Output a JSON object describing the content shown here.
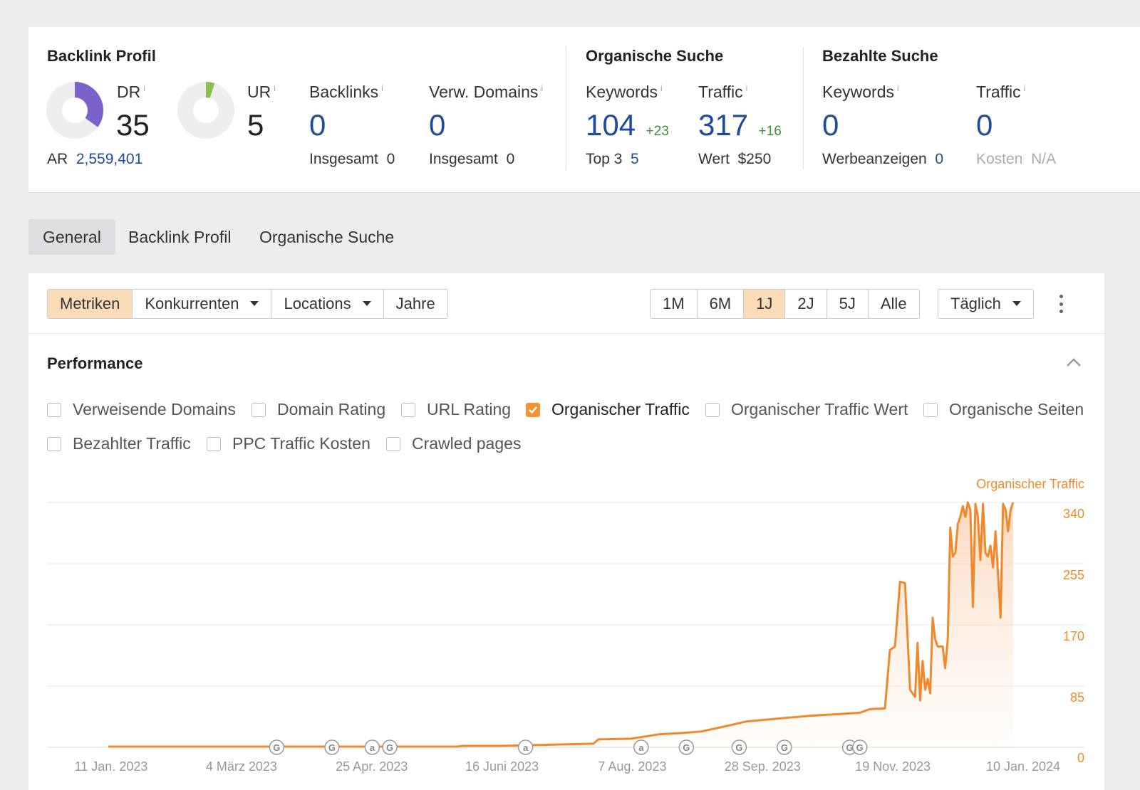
{
  "colors": {
    "accent": "#f29436",
    "link": "#1f4b9e",
    "positive": "#3d8f3d"
  },
  "backlink": {
    "title": "Backlink Profil",
    "dr": {
      "label": "DR",
      "info": "i",
      "value": "35",
      "fill": 0.35
    },
    "ur": {
      "label": "UR",
      "info": "i",
      "value": "5",
      "fill": 0.05
    },
    "ar_label": "AR",
    "ar_value": "2,559,401",
    "backlinks": {
      "label": "Backlinks",
      "info": "i",
      "value": "0",
      "sub_label": "Insgesamt",
      "sub_value": "0"
    },
    "domains": {
      "label": "Verw. Domains",
      "info": "i",
      "value": "0",
      "sub_label": "Insgesamt",
      "sub_value": "0"
    }
  },
  "organic": {
    "title": "Organische Suche",
    "keywords": {
      "label": "Keywords",
      "info": "i",
      "value": "104",
      "delta": "+23",
      "sub_label": "Top 3",
      "sub_value": "5"
    },
    "traffic": {
      "label": "Traffic",
      "info": "i",
      "value": "317",
      "delta": "+16",
      "sub_label": "Wert",
      "sub_value": "$250"
    }
  },
  "paid": {
    "title": "Bezahlte Suche",
    "keywords": {
      "label": "Keywords",
      "info": "i",
      "value": "0",
      "sub_label": "Werbeanzeigen",
      "sub_value": "0"
    },
    "traffic": {
      "label": "Traffic",
      "info": "i",
      "value": "0",
      "sub_label": "Kosten",
      "sub_value": "N/A"
    }
  },
  "tabs": [
    "General",
    "Backlink Profil",
    "Organische Suche"
  ],
  "toolbar": {
    "left": [
      "Metriken",
      "Konkurrenten",
      "Locations",
      "Jahre"
    ],
    "ranges": [
      "1M",
      "6M",
      "1J",
      "2J",
      "5J",
      "Alle"
    ],
    "interval": "Täglich",
    "active_range": "1J"
  },
  "performance": {
    "title": "Performance",
    "checkboxes": [
      {
        "label": "Verweisende Domains",
        "checked": false
      },
      {
        "label": "Domain Rating",
        "checked": false
      },
      {
        "label": "URL Rating",
        "checked": false
      },
      {
        "label": "Organischer Traffic",
        "checked": true
      },
      {
        "label": "Organischer Traffic Wert",
        "checked": false
      },
      {
        "label": "Organische Seiten",
        "checked": false
      },
      {
        "label": "Bezahlter Traffic",
        "checked": false
      },
      {
        "label": "PPC Traffic Kosten",
        "checked": false
      },
      {
        "label": "Crawled pages",
        "checked": false
      }
    ]
  },
  "chart_data": {
    "type": "area",
    "series": [
      {
        "name": "Organischer Traffic",
        "color": "#f29436"
      }
    ],
    "x_ticks": [
      "11 Jan. 2023",
      "4 März 2023",
      "25 Apr. 2023",
      "16 Juni 2023",
      "7 Aug. 2023",
      "28 Sep. 2023",
      "19 Nov. 2023",
      "10 Jan. 2024"
    ],
    "y_ticks": [
      "0",
      "85",
      "170",
      "255",
      "340"
    ],
    "ylim": [
      0,
      340
    ],
    "xlim": [
      "2023-01-11",
      "2024-01-10"
    ],
    "grid": true,
    "annotations": [
      {
        "date": "2023-03-19",
        "label": "G"
      },
      {
        "date": "2023-04-10",
        "label": "G"
      },
      {
        "date": "2023-04-26",
        "label": "a"
      },
      {
        "date": "2023-05-03",
        "label": "G"
      },
      {
        "date": "2023-06-26",
        "label": "a"
      },
      {
        "date": "2023-08-11",
        "label": "a"
      },
      {
        "date": "2023-08-29",
        "label": "G"
      },
      {
        "date": "2023-09-19",
        "label": "G"
      },
      {
        "date": "2023-10-07",
        "label": "G"
      },
      {
        "date": "2023-11-02",
        "label": "G"
      },
      {
        "date": "2023-11-06",
        "label": "G"
      }
    ],
    "points": [
      [
        "2023-01-11",
        1
      ],
      [
        "2023-03-04",
        1
      ],
      [
        "2023-04-25",
        1
      ],
      [
        "2023-05-30",
        1
      ],
      [
        "2023-06-01",
        2
      ],
      [
        "2023-06-16",
        2
      ],
      [
        "2023-06-28",
        3
      ],
      [
        "2023-07-10",
        4
      ],
      [
        "2023-07-23",
        5
      ],
      [
        "2023-07-25",
        11
      ],
      [
        "2023-08-07",
        12
      ],
      [
        "2023-08-18",
        18
      ],
      [
        "2023-08-28",
        20
      ],
      [
        "2023-09-04",
        22
      ],
      [
        "2023-09-12",
        28
      ],
      [
        "2023-09-22",
        36
      ],
      [
        "2023-10-05",
        40
      ],
      [
        "2023-10-18",
        44
      ],
      [
        "2023-10-28",
        46
      ],
      [
        "2023-11-06",
        48
      ],
      [
        "2023-11-10",
        53
      ],
      [
        "2023-11-16",
        54
      ],
      [
        "2023-11-18",
        135
      ],
      [
        "2023-11-20",
        140
      ],
      [
        "2023-11-22",
        230
      ],
      [
        "2023-11-24",
        228
      ],
      [
        "2023-11-26",
        80
      ],
      [
        "2023-11-28",
        70
      ],
      [
        "2023-11-29",
        145
      ],
      [
        "2023-11-30",
        65
      ],
      [
        "2023-12-01",
        120
      ],
      [
        "2023-12-02",
        80
      ],
      [
        "2023-12-03",
        95
      ],
      [
        "2023-12-04",
        75
      ],
      [
        "2023-12-05",
        180
      ],
      [
        "2023-12-06",
        150
      ],
      [
        "2023-12-07",
        140
      ],
      [
        "2023-12-09",
        140
      ],
      [
        "2023-12-10",
        110
      ],
      [
        "2023-12-11",
        150
      ],
      [
        "2023-12-12",
        305
      ],
      [
        "2023-12-13",
        265
      ],
      [
        "2023-12-14",
        270
      ],
      [
        "2023-12-15",
        310
      ],
      [
        "2023-12-16",
        320
      ],
      [
        "2023-12-17",
        335
      ],
      [
        "2023-12-18",
        320
      ],
      [
        "2023-12-19",
        340
      ],
      [
        "2023-12-20",
        330
      ],
      [
        "2023-12-21",
        195
      ],
      [
        "2023-12-22",
        338
      ],
      [
        "2023-12-23",
        320
      ],
      [
        "2023-12-24",
        260
      ],
      [
        "2023-12-25",
        338
      ],
      [
        "2023-12-26",
        270
      ],
      [
        "2023-12-27",
        265
      ],
      [
        "2023-12-28",
        280
      ],
      [
        "2023-12-29",
        250
      ],
      [
        "2023-12-30",
        300
      ],
      [
        "2024-01-01",
        180
      ],
      [
        "2024-01-02",
        338
      ],
      [
        "2024-01-03",
        330
      ],
      [
        "2024-01-04",
        300
      ],
      [
        "2024-01-05",
        330
      ],
      [
        "2024-01-06",
        340
      ]
    ]
  }
}
